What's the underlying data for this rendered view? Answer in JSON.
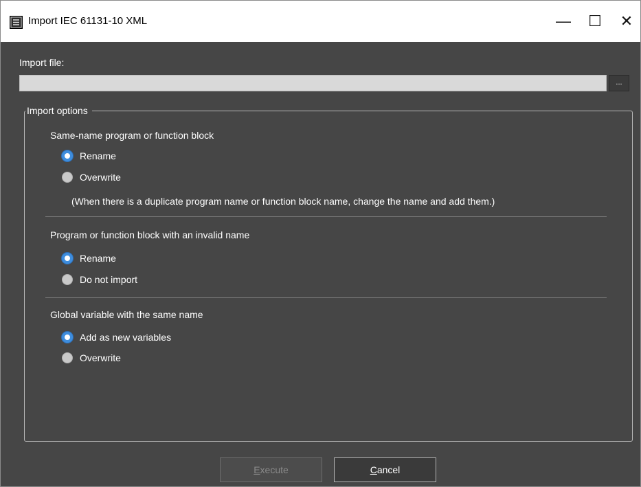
{
  "window": {
    "title": "Import IEC 61131-10 XML",
    "controls": {
      "minimize": "—",
      "maximize": "☐",
      "close": "✕"
    }
  },
  "import_file": {
    "label": "Import file:",
    "value": "",
    "browse_label": "..."
  },
  "import_options": {
    "legend": "Import options",
    "same_name": {
      "heading": "Same-name program or function block",
      "options": [
        {
          "label": "Rename",
          "selected": true
        },
        {
          "label": "Overwrite",
          "selected": false
        }
      ],
      "note": "(When there is a duplicate program name or function block name, change the name and add them.)"
    },
    "invalid_name": {
      "heading": "Program or function block with an invalid name",
      "options": [
        {
          "label": "Rename",
          "selected": true
        },
        {
          "label": "Do not import",
          "selected": false
        }
      ]
    },
    "global_variable": {
      "heading": "Global variable with the same name",
      "options": [
        {
          "label": "Add as new variables",
          "selected": true
        },
        {
          "label": "Overwrite",
          "selected": false
        }
      ]
    }
  },
  "buttons": {
    "execute": {
      "first": "E",
      "rest": "xecute",
      "enabled": false
    },
    "cancel": {
      "first": "C",
      "rest": "ancel",
      "enabled": true
    }
  },
  "colors": {
    "client_background": "#464646",
    "radio_selected": "#3e8ddd",
    "radio_unselected": "#c9c9c9"
  }
}
